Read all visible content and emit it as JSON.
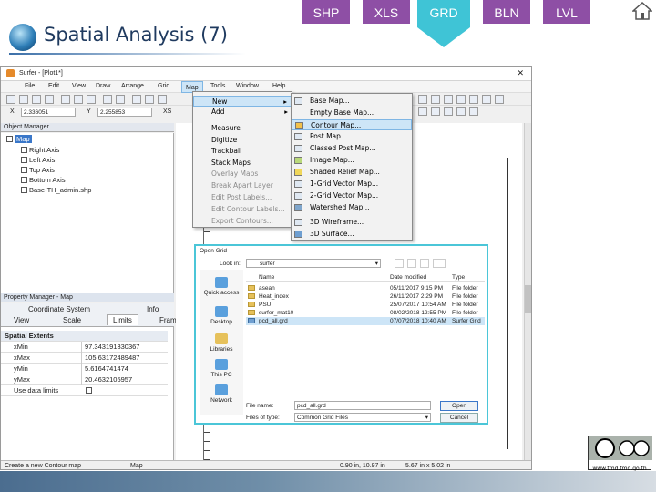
{
  "tabs": [
    {
      "label": "SHP",
      "color": "#8e4fa5"
    },
    {
      "label": "XLS",
      "color": "#8e4fa5"
    },
    {
      "label": "GRD",
      "color": "#3fc4d6"
    },
    {
      "label": "BLN",
      "color": "#8e4fa5"
    },
    {
      "label": "LVL",
      "color": "#8e4fa5"
    }
  ],
  "slide_title": "Spatial Analysis (7)",
  "app": {
    "window_title": "Surfer - [Plot1*]",
    "menu": [
      "File",
      "Edit",
      "View",
      "Draw",
      "Arrange",
      "Grid",
      "Map",
      "Tools",
      "Window",
      "Help"
    ],
    "coords": {
      "x_label": "X",
      "x_value": "2.336051",
      "y_label": "Y",
      "y_value": "2.255853",
      "xs_label": "XS"
    },
    "object_manager": {
      "title": "Object Manager",
      "items": [
        "Map",
        "Right Axis",
        "Left Axis",
        "Top Axis",
        "Bottom Axis",
        "Base-TH_admin.shp"
      ]
    },
    "map_menu": {
      "items": [
        "New",
        "Add",
        "Measure",
        "Digitize",
        "Trackball",
        "Stack Maps",
        "Overlay Maps",
        "Break Apart Layer",
        "Edit Post Labels...",
        "Edit Contour Labels...",
        "Export Contours..."
      ]
    },
    "new_submenu": {
      "items": [
        "Base Map...",
        "Empty Base Map...",
        "Contour Map...",
        "Post Map...",
        "Classed Post Map...",
        "Image Map...",
        "Shaded Relief Map...",
        "1-Grid Vector Map...",
        "2-Grid Vector Map...",
        "Watershed Map...",
        "3D Wireframe...",
        "3D Surface..."
      ]
    },
    "property_manager": {
      "title": "Property Manager - Map",
      "tabs_row1": [
        "Coordinate System",
        "Info"
      ],
      "tabs_row2": [
        "View",
        "Scale",
        "Limits",
        "Frame"
      ],
      "section": "Spatial Extents",
      "rows": [
        {
          "k": "xMin",
          "v": "97.343191330367"
        },
        {
          "k": "xMax",
          "v": "105.63172489487"
        },
        {
          "k": "yMin",
          "v": "5.6164741474"
        },
        {
          "k": "yMax",
          "v": "20.4632105957"
        },
        {
          "k": "Use data limits",
          "v": ""
        }
      ]
    },
    "status": {
      "left": "Create a new Contour map",
      "mid": "Map",
      "coords": "0.90 in, 10.97 in",
      "size": "5.67 in x 5.02 in"
    }
  },
  "dialog": {
    "title": "Open Grid",
    "look_in_label": "Look in:",
    "look_in_value": "surfer",
    "places": [
      "Quick access",
      "Desktop",
      "Libraries",
      "This PC",
      "Network"
    ],
    "columns": [
      "Name",
      "Date modified",
      "Type"
    ],
    "files": [
      {
        "name": "asean",
        "date": "05/11/2017 9:15 PM",
        "type": "File folder"
      },
      {
        "name": "Heat_index",
        "date": "26/11/2017 2:29 PM",
        "type": "File folder"
      },
      {
        "name": "PSU",
        "date": "25/07/2017 10:54 AM",
        "type": "File folder"
      },
      {
        "name": "surfer_mat10",
        "date": "08/02/2018 12:55 PM",
        "type": "File folder"
      },
      {
        "name": "pcd_all.grd",
        "date": "07/07/2018 10:40 AM",
        "type": "Surfer Grid"
      }
    ],
    "filename_label": "File name:",
    "filename_value": "pcd_all.grd",
    "filetype_label": "Files of type:",
    "filetype_value": "Common Grid Files",
    "open_label": "Open",
    "cancel_label": "Cancel"
  },
  "footer": {
    "url": "www.tmd.tmd.go.th"
  }
}
